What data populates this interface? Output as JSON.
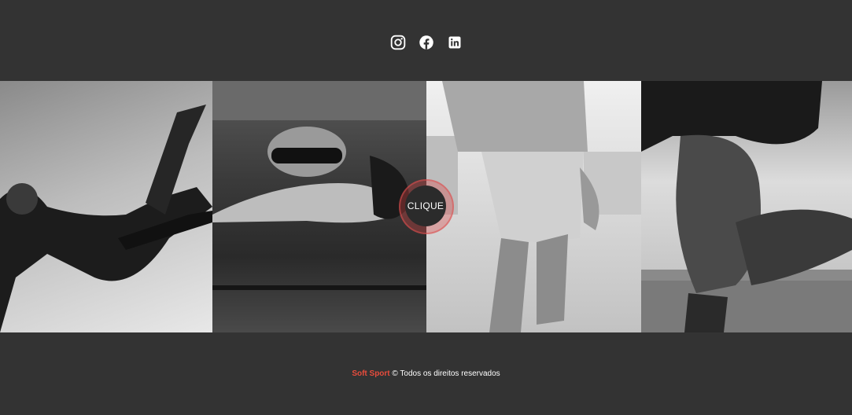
{
  "social": {
    "icons": [
      "instagram-icon",
      "facebook-icon",
      "linkedin-icon"
    ]
  },
  "gallery": {
    "panels": [
      "soccer",
      "swimming",
      "basketball",
      "running"
    ]
  },
  "cta": {
    "label": "CLIQUE"
  },
  "footer": {
    "brand": "Soft Sport",
    "text": "© Todos os direitos reservados"
  },
  "colors": {
    "background": "#333333",
    "accent": "#e74c3c",
    "text": "#ffffff"
  }
}
